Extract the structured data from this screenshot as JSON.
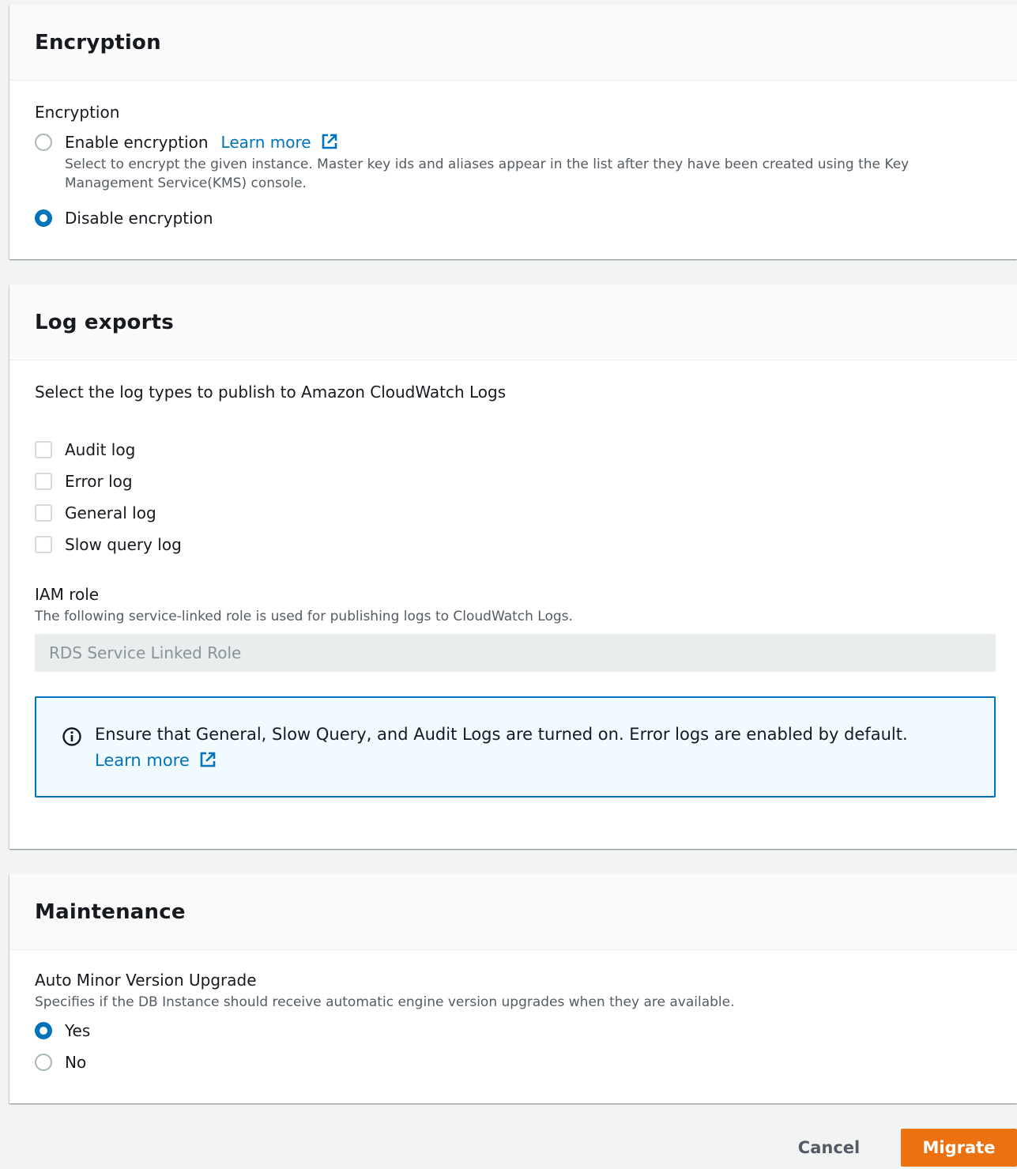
{
  "encryption": {
    "title": "Encryption",
    "field_label": "Encryption",
    "options": [
      {
        "label": "Enable encryption",
        "learn_more": "Learn more",
        "description": "Select to encrypt the given instance. Master key ids and aliases appear in the list after they have been created using the Key Management Service(KMS) console.",
        "selected": false
      },
      {
        "label": "Disable encryption",
        "selected": true
      }
    ]
  },
  "log_exports": {
    "title": "Log exports",
    "intro": "Select the log types to publish to Amazon CloudWatch Logs",
    "log_types": [
      {
        "label": "Audit log",
        "checked": false
      },
      {
        "label": "Error log",
        "checked": false
      },
      {
        "label": "General log",
        "checked": false
      },
      {
        "label": "Slow query log",
        "checked": false
      }
    ],
    "iam_role": {
      "label": "IAM role",
      "description": "The following service-linked role is used for publishing logs to CloudWatch Logs.",
      "value": "RDS Service Linked Role"
    },
    "info": {
      "text": "Ensure that General, Slow Query, and Audit Logs are turned on. Error logs are enabled by default.",
      "link": "Learn more"
    }
  },
  "maintenance": {
    "title": "Maintenance",
    "field_label": "Auto Minor Version Upgrade",
    "description": "Specifies if the DB Instance should receive automatic engine version upgrades when they are available.",
    "options": [
      {
        "label": "Yes",
        "selected": true
      },
      {
        "label": "No",
        "selected": false
      }
    ]
  },
  "footer": {
    "cancel_label": "Cancel",
    "migrate_label": "Migrate"
  },
  "colors": {
    "link": "#0073bb",
    "primary_button": "#ec7211",
    "info_border": "#0073bb",
    "info_background": "#f1faff"
  },
  "icons": {
    "external_link": "external-link-icon",
    "info": "info-circle-icon"
  }
}
